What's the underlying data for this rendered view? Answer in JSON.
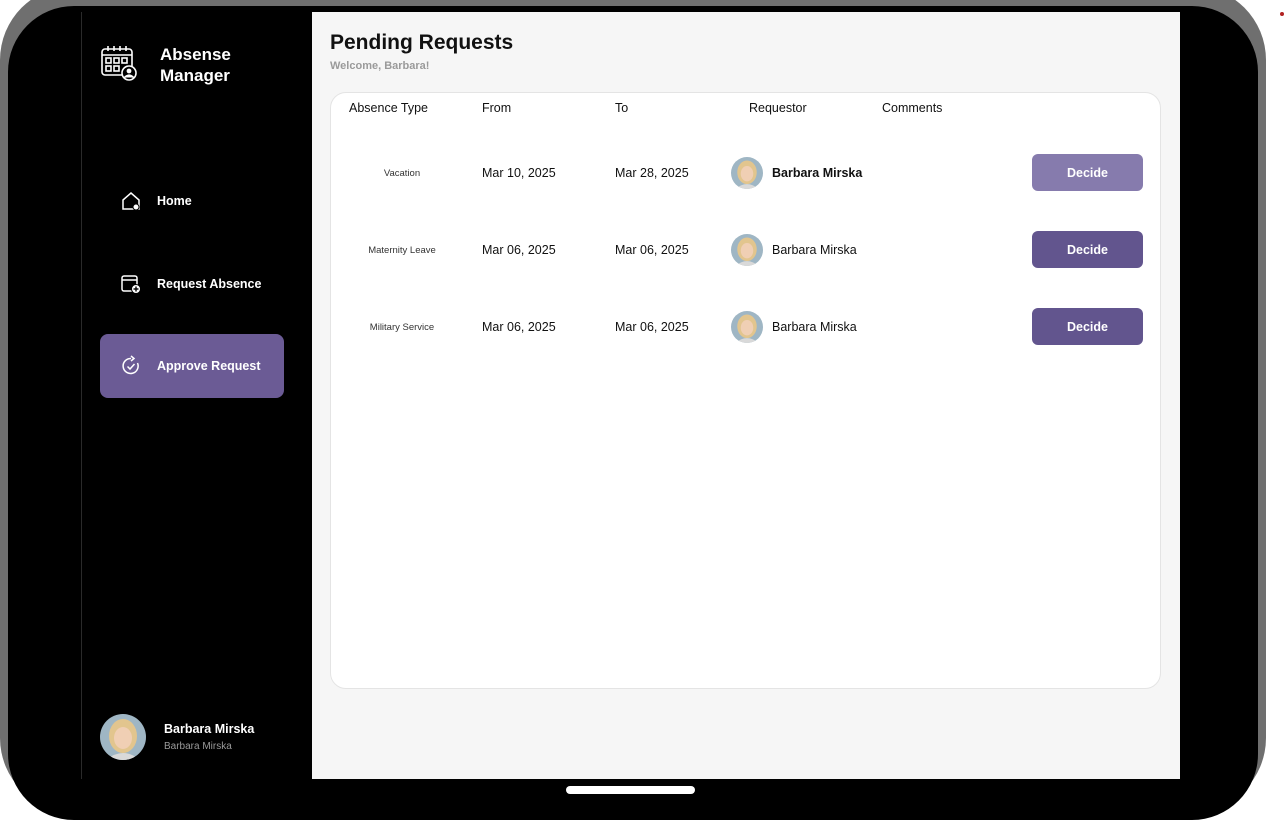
{
  "app": {
    "title": "Absense Manager"
  },
  "sidebar": {
    "items": [
      {
        "label": "Home",
        "icon": "home-icon"
      },
      {
        "label": "Request Absence",
        "icon": "calendar-add-icon"
      },
      {
        "label": "Approve Request",
        "icon": "approve-refresh-icon",
        "active": true
      }
    ],
    "user": {
      "name": "Barbara Mirska",
      "subtitle": "Barbara Mirska"
    }
  },
  "main": {
    "title": "Pending Requests",
    "welcome": "Welcome, Barbara!",
    "columns": [
      "Absence Type",
      "From",
      "To",
      "Requestor",
      "Comments"
    ],
    "rows": [
      {
        "type": "Vacation",
        "from": "Mar 10, 2025",
        "to": "Mar 28, 2025",
        "requestor": "Barbara Mirska",
        "comments": "",
        "action": "Decide"
      },
      {
        "type": "Maternity Leave",
        "from": "Mar 06, 2025",
        "to": "Mar 06, 2025",
        "requestor": "Barbara Mirska",
        "comments": "",
        "action": "Decide"
      },
      {
        "type": "Military Service",
        "from": "Mar 06, 2025",
        "to": "Mar 06, 2025",
        "requestor": "Barbara Mirska",
        "comments": "",
        "action": "Decide"
      }
    ]
  },
  "colors": {
    "accent": "#6b5b95",
    "button": "#62558e",
    "button_hover": "#867bad",
    "sidebar_bg": "#000000",
    "main_bg": "#f6f6f6"
  }
}
